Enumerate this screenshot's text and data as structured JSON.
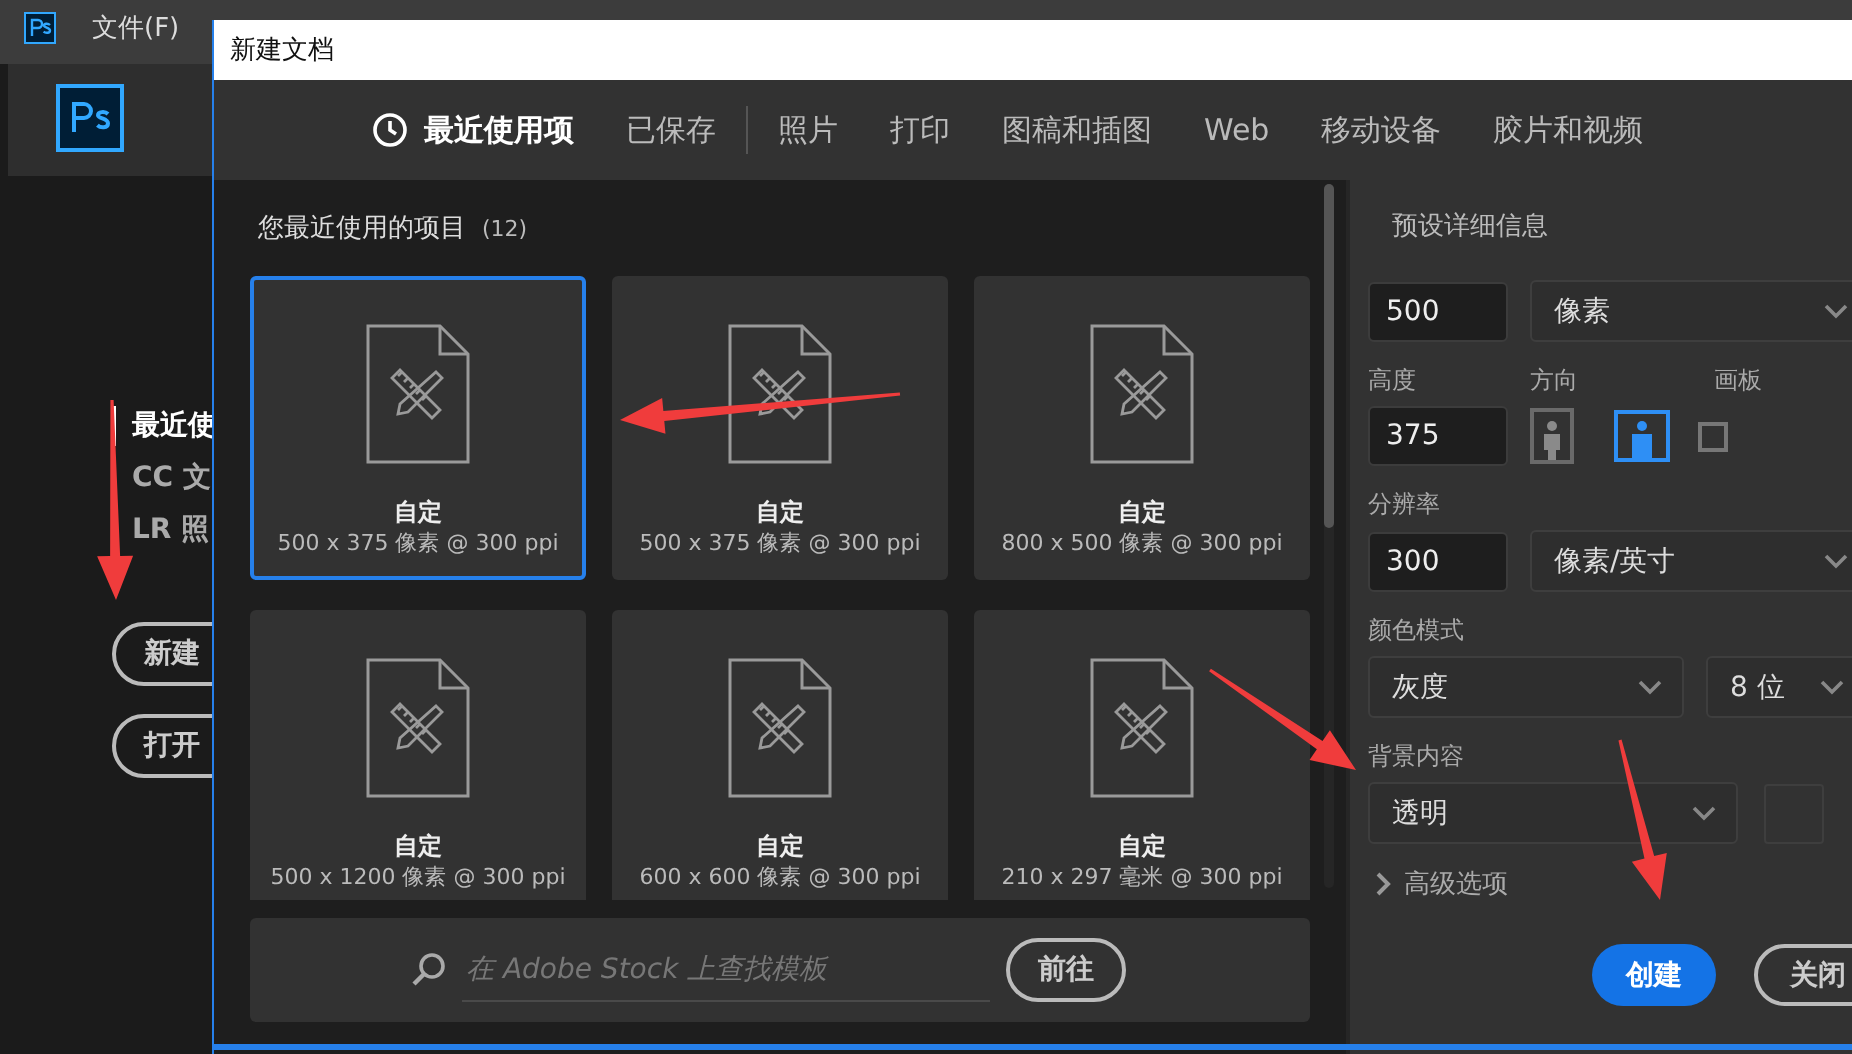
{
  "app": {
    "menu": [
      "文件(F)"
    ],
    "home_nav": [
      {
        "label": "最近使",
        "selected": true
      },
      {
        "label": "CC 文",
        "selected": false
      },
      {
        "label": "LR 照",
        "selected": false
      }
    ],
    "home_buttons": [
      "新建",
      "打开"
    ]
  },
  "dialog": {
    "title": "新建文档",
    "tabs": [
      {
        "label": "最近使用项",
        "selected": true
      },
      {
        "label": "已保存",
        "selected": false
      },
      {
        "label": "照片",
        "selected": false
      },
      {
        "label": "打印",
        "selected": false
      },
      {
        "label": "图稿和插图",
        "selected": false
      },
      {
        "label": "Web",
        "selected": false
      },
      {
        "label": "移动设备",
        "selected": false
      },
      {
        "label": "胶片和视频",
        "selected": false
      }
    ],
    "recent": {
      "heading": "您最近使用的项目",
      "count": "(12)",
      "presets": [
        {
          "name": "自定",
          "size": "500 x 375 像素 @ 300 ppi",
          "selected": true
        },
        {
          "name": "自定",
          "size": "500 x 375 像素 @ 300 ppi",
          "selected": false
        },
        {
          "name": "自定",
          "size": "800 x 500 像素 @ 300 ppi",
          "selected": false
        },
        {
          "name": "自定",
          "size": "500 x 1200 像素 @ 300 ppi",
          "selected": false
        },
        {
          "name": "自定",
          "size": "600 x 600 像素 @ 300 ppi",
          "selected": false
        },
        {
          "name": "自定",
          "size": "210 x 297 毫米 @ 300 ppi",
          "selected": false
        }
      ]
    },
    "stock_search": {
      "placeholder": "在 Adobe Stock 上查找模板",
      "button": "前往"
    },
    "details": {
      "title": "预设详细信息",
      "width": {
        "value": "500",
        "unit": "像素"
      },
      "height": {
        "label": "高度",
        "value": "375"
      },
      "orientation": {
        "label": "方向",
        "options": [
          {
            "kind": "portrait",
            "selected": false
          },
          {
            "kind": "landscape",
            "selected": true
          }
        ]
      },
      "artboard": {
        "label": "画板",
        "checked": false
      },
      "resolution": {
        "label": "分辨率",
        "value": "300",
        "unit": "像素/英寸"
      },
      "color_mode": {
        "label": "颜色模式",
        "mode": "灰度",
        "depth": "8 位"
      },
      "background": {
        "label": "背景内容",
        "value": "透明"
      },
      "advanced": {
        "label": "高级选项",
        "expanded": false
      },
      "buttons": [
        {
          "label": "创建",
          "kind": "primary"
        },
        {
          "label": "关闭",
          "kind": "secondary"
        }
      ]
    }
  },
  "annotations": [
    {
      "kind": "arrow"
    },
    {
      "kind": "arrow"
    },
    {
      "kind": "arrow"
    },
    {
      "kind": "arrow"
    }
  ]
}
